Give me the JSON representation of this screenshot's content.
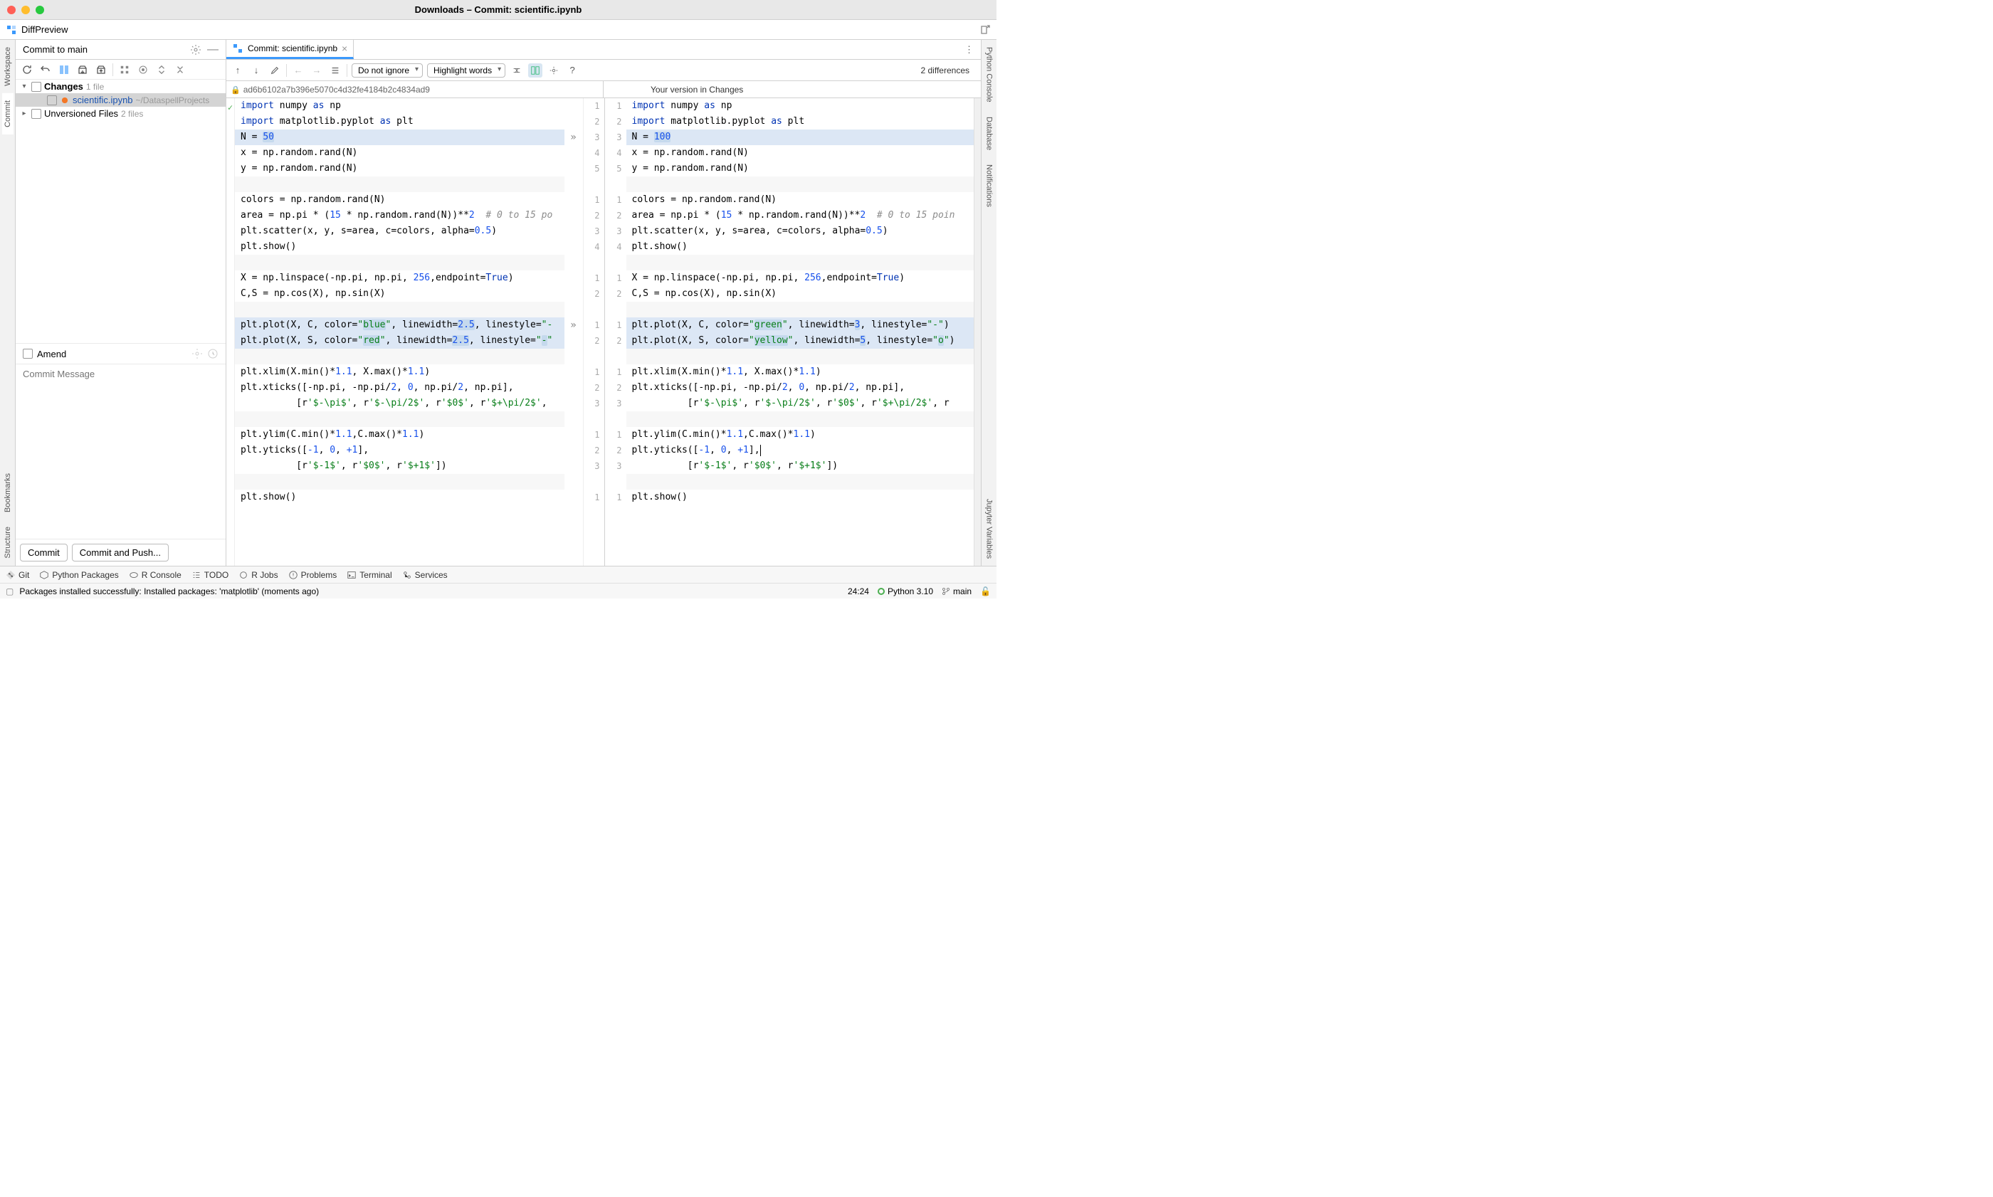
{
  "window_title": "Downloads – Commit: scientific.ipynb",
  "diffpreview_label": "DiffPreview",
  "left_tabs": [
    "Workspace",
    "Commit",
    "Bookmarks",
    "Structure"
  ],
  "right_tabs": [
    "Python Console",
    "Database",
    "Notifications",
    "Jupyter Variables"
  ],
  "commit_panel": {
    "title": "Commit to main",
    "changes_label": "Changes",
    "changes_count": "1 file",
    "file_name": "scientific.ipynb",
    "file_path": "~/DataspellProjects",
    "unversioned_label": "Unversioned Files",
    "unversioned_count": "2 files",
    "amend_label": "Amend",
    "msg_placeholder": "Commit Message",
    "commit_btn": "Commit",
    "commit_push_btn": "Commit and Push..."
  },
  "editor": {
    "tab_label": "Commit: scientific.ipynb",
    "ignore_select": "Do not ignore",
    "highlight_select": "Highlight words",
    "diff_count": "2 differences",
    "left_header_hash": "ad6b6102a7b396e5070c4d32fe4184b2c4834ad9",
    "right_header": "Your version in Changes"
  },
  "diff": {
    "blocks": [
      {
        "left_lines": [
          {
            "n": "1",
            "html": "<span class='kw'>import</span> numpy <span class='as'>as</span> np"
          },
          {
            "n": "2",
            "html": "<span class='kw'>import</span> matplotlib.pyplot <span class='as'>as</span> plt"
          },
          {
            "n": "3",
            "html": "N = <span class='num hl'>50</span>",
            "cls": "changed",
            "arrow": "»"
          },
          {
            "n": "4",
            "html": "x = np.random.rand(N)"
          },
          {
            "n": "5",
            "html": "y = np.random.rand(N)"
          }
        ],
        "right_lines": [
          {
            "n": "1",
            "html": "<span class='kw'>import</span> numpy <span class='as'>as</span> np"
          },
          {
            "n": "2",
            "html": "<span class='kw'>import</span> matplotlib.pyplot <span class='as'>as</span> plt"
          },
          {
            "n": "3",
            "html": "N = <span class='num hl'>100</span>",
            "cls": "changed"
          },
          {
            "n": "4",
            "html": "x = np.random.rand(N)"
          },
          {
            "n": "5",
            "html": "y = np.random.rand(N)"
          }
        ]
      },
      {
        "left_lines": [
          {
            "blank": true
          }
        ],
        "right_lines": [
          {
            "blank": true
          }
        ]
      },
      {
        "left_lines": [
          {
            "n": "1",
            "html": "colors = np.random.rand(N)"
          },
          {
            "n": "2",
            "html": "area = np.pi * (<span class='num'>15</span> * np.random.rand(N))**<span class='num'>2</span>  <span class='cmt'># 0 to 15 po</span>"
          },
          {
            "n": "3",
            "html": "plt.scatter(x, y, s=area, c=colors, alpha=<span class='num'>0.5</span>)"
          },
          {
            "n": "4",
            "html": "plt.show()"
          }
        ],
        "right_lines": [
          {
            "n": "1",
            "html": "colors = np.random.rand(N)"
          },
          {
            "n": "2",
            "html": "area = np.pi * (<span class='num'>15</span> * np.random.rand(N))**<span class='num'>2</span>  <span class='cmt'># 0 to 15 poin</span>"
          },
          {
            "n": "3",
            "html": "plt.scatter(x, y, s=area, c=colors, alpha=<span class='num'>0.5</span>)"
          },
          {
            "n": "4",
            "html": "plt.show()"
          }
        ]
      },
      {
        "left_lines": [
          {
            "blank": true
          }
        ],
        "right_lines": [
          {
            "blank": true
          }
        ]
      },
      {
        "left_lines": [
          {
            "n": "1",
            "html": "X = np.linspace(-np.pi, np.pi, <span class='num'>256</span>,endpoint=<span class='bool'>True</span>)"
          },
          {
            "n": "2",
            "html": "C,S = np.cos(X), np.sin(X)"
          }
        ],
        "right_lines": [
          {
            "n": "1",
            "html": "X = np.linspace(-np.pi, np.pi, <span class='num'>256</span>,endpoint=<span class='bool'>True</span>)"
          },
          {
            "n": "2",
            "html": "C,S = np.cos(X), np.sin(X)"
          }
        ]
      },
      {
        "left_lines": [
          {
            "blank": true
          }
        ],
        "right_lines": [
          {
            "blank": true
          }
        ]
      },
      {
        "left_lines": [
          {
            "n": "1",
            "html": "plt.plot(X, C, color=<span class='str'>\"<span class='hl'>blue</span>\"</span>, linewidth=<span class='num hl'>2.5</span>, linestyle=<span class='str'>\"-</span>",
            "cls": "changed",
            "arrow": "»"
          },
          {
            "n": "2",
            "html": "plt.plot(X, S, color=<span class='str'>\"<span class='hl'>red</span>\"</span>, linewidth=<span class='num hl'>2.5</span>, linestyle=<span class='str'>\"<span class='hl'>-</span>\"</span>",
            "cls": "changed"
          }
        ],
        "right_lines": [
          {
            "n": "1",
            "html": "plt.plot(X, C, color=<span class='str'>\"<span class='hl'>green</span>\"</span>, linewidth=<span class='num hl'>3</span>, linestyle=<span class='str'>\"-\"</span>)",
            "cls": "changed"
          },
          {
            "n": "2",
            "html": "plt.plot(X, S, color=<span class='str'>\"<span class='hl'>yellow</span>\"</span>, linewidth=<span class='num hl'>5</span>, linestyle=<span class='str'>\"<span class='hl'>o</span>\"</span>)",
            "cls": "changed"
          }
        ]
      },
      {
        "left_lines": [
          {
            "blank": true
          }
        ],
        "right_lines": [
          {
            "blank": true
          }
        ]
      },
      {
        "left_lines": [
          {
            "n": "1",
            "html": "plt.xlim(X.min()*<span class='num'>1.1</span>, X.max()*<span class='num'>1.1</span>)"
          },
          {
            "n": "2",
            "html": "plt.xticks([-np.pi, -np.pi/<span class='num'>2</span>, <span class='num'>0</span>, np.pi/<span class='num'>2</span>, np.pi],"
          },
          {
            "n": "3",
            "html": "          [r<span class='str'>'$-\\pi$'</span>, r<span class='str'>'$-\\pi/2$'</span>, r<span class='str'>'$0$'</span>, r<span class='str'>'$+\\pi/2$'</span>,"
          }
        ],
        "right_lines": [
          {
            "n": "1",
            "html": "plt.xlim(X.min()*<span class='num'>1.1</span>, X.max()*<span class='num'>1.1</span>)"
          },
          {
            "n": "2",
            "html": "plt.xticks([-np.pi, -np.pi/<span class='num'>2</span>, <span class='num'>0</span>, np.pi/<span class='num'>2</span>, np.pi],"
          },
          {
            "n": "3",
            "html": "          [r<span class='str'>'$-\\pi$'</span>, r<span class='str'>'$-\\pi/2$'</span>, r<span class='str'>'$0$'</span>, r<span class='str'>'$+\\pi/2$'</span>, r"
          }
        ]
      },
      {
        "left_lines": [
          {
            "blank": true
          }
        ],
        "right_lines": [
          {
            "blank": true
          }
        ]
      },
      {
        "left_lines": [
          {
            "n": "1",
            "html": "plt.ylim(C.min()*<span class='num'>1.1</span>,C.max()*<span class='num'>1.1</span>)"
          },
          {
            "n": "2",
            "html": "plt.yticks([<span class='num'>-1</span>, <span class='num'>0</span>, <span class='num'>+1</span>],"
          },
          {
            "n": "3",
            "html": "          [r<span class='str'>'$-1$'</span>, r<span class='str'>'$0$'</span>, r<span class='str'>'$+1$'</span>])"
          }
        ],
        "right_lines": [
          {
            "n": "1",
            "html": "plt.ylim(C.min()*<span class='num'>1.1</span>,C.max()*<span class='num'>1.1</span>)"
          },
          {
            "n": "2",
            "html": "plt.yticks([<span class='num'>-1</span>, <span class='num'>0</span>, <span class='num'>+1</span>],<span class='cursor-bar'></span>"
          },
          {
            "n": "3",
            "html": "          [r<span class='str'>'$-1$'</span>, r<span class='str'>'$0$'</span>, r<span class='str'>'$+1$'</span>])"
          }
        ]
      },
      {
        "left_lines": [
          {
            "blank": true
          }
        ],
        "right_lines": [
          {
            "blank": true
          }
        ]
      },
      {
        "left_lines": [
          {
            "n": "1",
            "html": "plt.show()"
          }
        ],
        "right_lines": [
          {
            "n": "1",
            "html": "plt.show()"
          }
        ]
      }
    ]
  },
  "bottom_bar": {
    "items": [
      "Git",
      "Python Packages",
      "R Console",
      "TODO",
      "R Jobs",
      "Problems",
      "Terminal",
      "Services"
    ]
  },
  "status_bar": {
    "message": "Packages installed successfully: Installed packages: 'matplotlib' (moments ago)",
    "pos": "24:24",
    "python": "Python 3.10",
    "branch": "main"
  }
}
